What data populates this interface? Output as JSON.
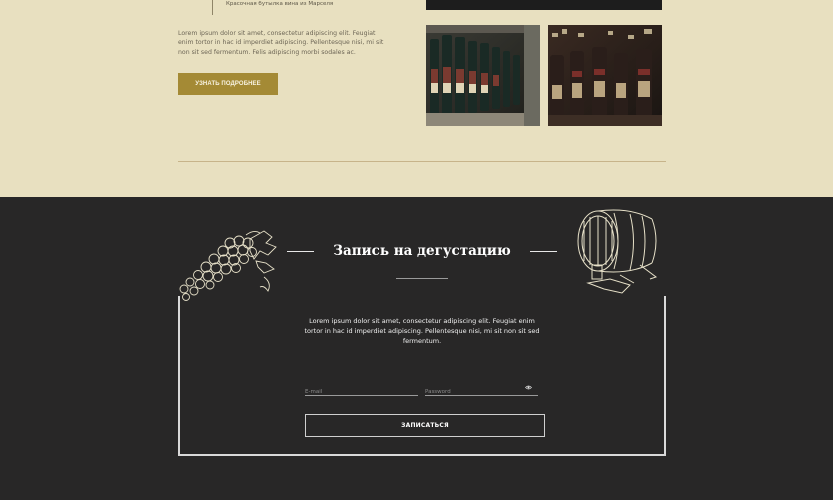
{
  "about": {
    "caption": "Красочная бутылка вина из Марселя",
    "text": "Lorem ipsum dolor sit amet, consectetur adipiscing elit. Feugiat enim tortor in hac id imperdiet adipiscing. Pellentesque nisi, mi sit non sit sed fermentum. Felis adipiscing morbi sodales ac.",
    "more_button": "УЗНАТЬ ПОДРОБНЕЕ"
  },
  "tasting": {
    "title": "Запись на дегустацию",
    "text": "Lorem ipsum dolor sit amet, consectetur adipiscing elit. Feugiat enim tortor in hac id imperdiet adipiscing. Pellentesque nisi, mi sit non sit sed fermentum.",
    "email_placeholder": "E-mail",
    "password_placeholder": "Password",
    "submit_button": "ЗАПИСАТЬСЯ"
  },
  "colors": {
    "cream_bg": "#e8e0c0",
    "dark_bg": "#282727",
    "accent": "#a48a35"
  },
  "icons": [
    "eye-icon",
    "grapes-illustration",
    "barrel-illustration"
  ]
}
